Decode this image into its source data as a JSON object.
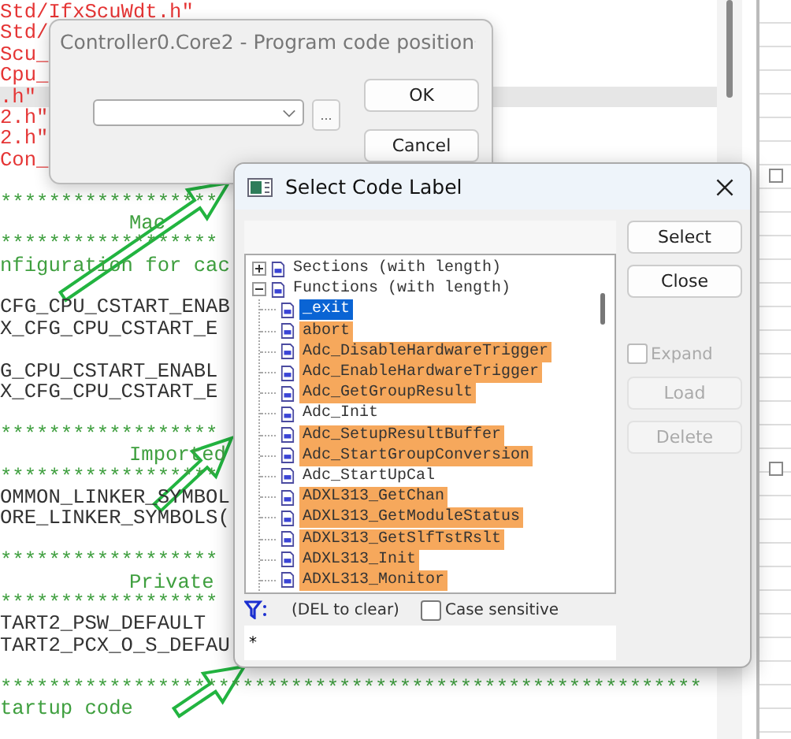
{
  "editor": {
    "lines": [
      {
        "kind": "string",
        "text": "Std/IfxScuWdt.h\"",
        "current": false,
        "space_before": false
      },
      {
        "kind": "string",
        "text": "Std/",
        "current": false,
        "space_before": false
      },
      {
        "kind": "string",
        "text": "Scu_",
        "current": false,
        "space_before": false
      },
      {
        "kind": "string",
        "text": "Cpu_",
        "current": false,
        "space_before": false
      },
      {
        "kind": "string",
        "text": ".h\"",
        "current": true,
        "space_before": false
      },
      {
        "kind": "string",
        "text": "2.h\"",
        "current": false,
        "space_before": false
      },
      {
        "kind": "string",
        "text": "2.h\"",
        "current": false,
        "space_before": false
      },
      {
        "kind": "string",
        "text": "Con_",
        "current": false,
        "space_before": false
      },
      {
        "kind": "stars",
        "text": "******************",
        "current": false,
        "space_before": true
      },
      {
        "kind": "banner",
        "text": "Mac",
        "current": false,
        "space_before": false
      },
      {
        "kind": "stars",
        "text": "******************",
        "current": false,
        "space_before": false
      },
      {
        "kind": "comment",
        "text": "nfiguration for cac",
        "current": false,
        "space_before": false
      },
      {
        "kind": "code",
        "text": "CFG_CPU_CSTART_ENAB",
        "current": false,
        "space_before": true
      },
      {
        "kind": "code",
        "text": "X_CFG_CPU_CSTART_E",
        "current": false,
        "space_before": false
      },
      {
        "kind": "code",
        "text": "G_CPU_CSTART_ENABL",
        "current": false,
        "space_before": true
      },
      {
        "kind": "code",
        "text": "X_CFG_CPU_CSTART_E",
        "current": false,
        "space_before": false
      },
      {
        "kind": "stars",
        "text": "******************",
        "current": false,
        "space_before": true
      },
      {
        "kind": "banner",
        "text": "Imported",
        "current": false,
        "space_before": false
      },
      {
        "kind": "stars",
        "text": "******************",
        "current": false,
        "space_before": false
      },
      {
        "kind": "code",
        "text": "OMMON_LINKER_SYMBOL",
        "current": false,
        "space_before": false
      },
      {
        "kind": "code",
        "text": "ORE_LINKER_SYMBOLS(",
        "current": false,
        "space_before": false
      },
      {
        "kind": "stars",
        "text": "******************",
        "current": false,
        "space_before": true
      },
      {
        "kind": "banner",
        "text": "Private",
        "current": false,
        "space_before": false
      },
      {
        "kind": "stars",
        "text": "******************",
        "current": false,
        "space_before": false
      },
      {
        "kind": "code",
        "text": "TART2_PSW_DEFAULT",
        "current": false,
        "space_before": false
      },
      {
        "kind": "code",
        "text": "TART2_PCX_O_S_DEFAU",
        "current": false,
        "space_before": false
      },
      {
        "kind": "stars",
        "text": "**********************************************************",
        "current": false,
        "space_before": true
      },
      {
        "kind": "comment",
        "text": "tartup code",
        "current": false,
        "space_before": false
      }
    ]
  },
  "position_dialog": {
    "title": "Controller0.Core2 - Program code position",
    "browse_button": "...",
    "buttons": [
      "OK",
      "Cancel"
    ]
  },
  "label_dialog": {
    "title": "Select Code Label",
    "tree": [
      {
        "label": "Sections (with length)",
        "expanded": false,
        "selected": false
      },
      {
        "label": "Functions (with length)",
        "expanded": true,
        "selected": false,
        "children": [
          {
            "label": "_exit",
            "selected": true,
            "highlighted": false
          },
          {
            "label": "abort",
            "selected": false,
            "highlighted": true
          },
          {
            "label": "Adc_DisableHardwareTrigger",
            "selected": false,
            "highlighted": true
          },
          {
            "label": "Adc_EnableHardwareTrigger",
            "selected": false,
            "highlighted": true
          },
          {
            "label": "Adc_GetGroupResult",
            "selected": false,
            "highlighted": true
          },
          {
            "label": "Adc_Init",
            "selected": false,
            "highlighted": false
          },
          {
            "label": "Adc_SetupResultBuffer",
            "selected": false,
            "highlighted": true
          },
          {
            "label": "Adc_StartGroupConversion",
            "selected": false,
            "highlighted": true
          },
          {
            "label": "Adc_StartUpCal",
            "selected": false,
            "highlighted": false
          },
          {
            "label": "ADXL313_GetChan",
            "selected": false,
            "highlighted": true
          },
          {
            "label": "ADXL313_GetModuleStatus",
            "selected": false,
            "highlighted": true
          },
          {
            "label": "ADXL313_GetSlfTstRslt",
            "selected": false,
            "highlighted": true
          },
          {
            "label": "ADXL313_Init",
            "selected": false,
            "highlighted": true
          },
          {
            "label": "ADXL313_Monitor",
            "selected": false,
            "highlighted": true
          }
        ]
      }
    ],
    "controls": [
      {
        "kind": "button",
        "label": "Select",
        "disabled": false
      },
      {
        "kind": "button",
        "label": "Close",
        "disabled": false
      },
      {
        "kind": "checkbox",
        "label": "Expand",
        "checked": false,
        "disabled": true
      },
      {
        "kind": "button",
        "label": "Load",
        "disabled": true
      },
      {
        "kind": "button",
        "label": "Delete",
        "disabled": true
      }
    ],
    "filter": {
      "hint": "(DEL to clear)",
      "value": "*",
      "case_sensitive": {
        "label": "Case sensitive",
        "checked": false
      }
    }
  }
}
